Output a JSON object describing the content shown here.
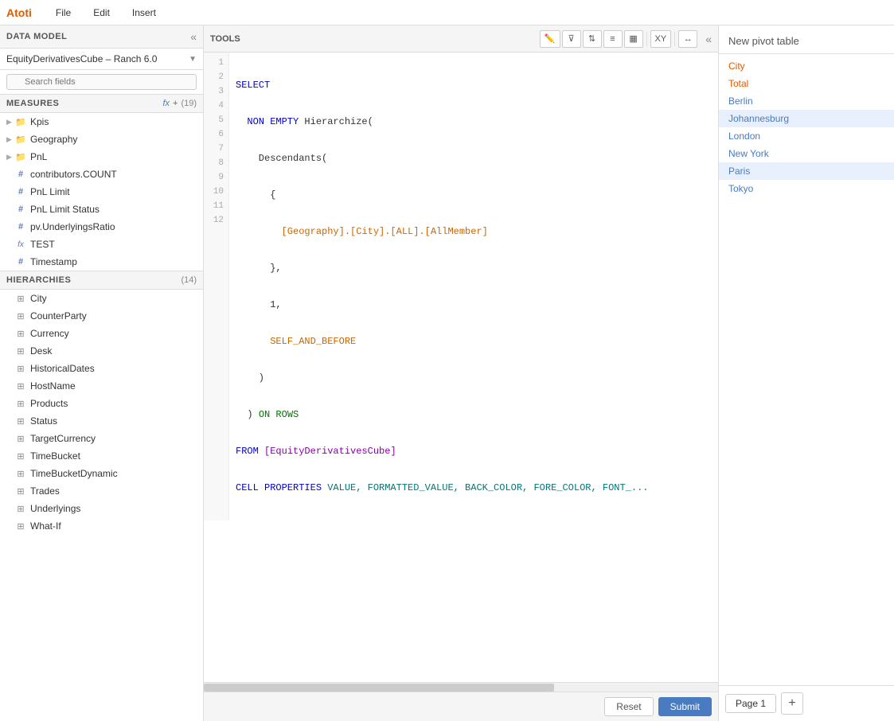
{
  "app": {
    "logo": "Atoti",
    "menu_items": [
      "File",
      "Edit",
      "Insert"
    ]
  },
  "left_panel": {
    "header": "DATA MODEL",
    "cube_selector": "EquityDerivativesCube – Ranch 6.0",
    "search_placeholder": "Search fields",
    "measures_section": {
      "title": "MEASURES",
      "fx_label": "fx",
      "plus_label": "+",
      "count_label": "(19)",
      "items": [
        {
          "name": "Kpis",
          "icon": "folder",
          "type": "folder"
        },
        {
          "name": "Geography",
          "icon": "folder",
          "type": "folder"
        },
        {
          "name": "PnL",
          "icon": "folder",
          "type": "folder"
        },
        {
          "name": "contributors.COUNT",
          "icon": "hash",
          "type": "measure"
        },
        {
          "name": "PnL Limit",
          "icon": "hash",
          "type": "measure"
        },
        {
          "name": "PnL Limit Status",
          "icon": "hash",
          "type": "measure"
        },
        {
          "name": "pv.UnderlyingsRatio",
          "icon": "hash",
          "type": "measure"
        },
        {
          "name": "TEST",
          "icon": "fx",
          "type": "calc"
        },
        {
          "name": "Timestamp",
          "icon": "hash",
          "type": "measure"
        }
      ]
    },
    "hierarchies_section": {
      "title": "HIERARCHIES",
      "count_label": "(14)",
      "items": [
        {
          "name": "City"
        },
        {
          "name": "CounterParty"
        },
        {
          "name": "Currency"
        },
        {
          "name": "Desk"
        },
        {
          "name": "HistoricalDates"
        },
        {
          "name": "HostName"
        },
        {
          "name": "Products"
        },
        {
          "name": "Status"
        },
        {
          "name": "TargetCurrency"
        },
        {
          "name": "TimeBucket"
        },
        {
          "name": "TimeBucketDynamic"
        },
        {
          "name": "Trades"
        },
        {
          "name": "Underlyings"
        },
        {
          "name": "What-If"
        }
      ]
    }
  },
  "tools_panel": {
    "title": "TOOLS",
    "toolbar_buttons": [
      "pencil",
      "filter",
      "sort-az",
      "bar-chart",
      "table",
      "xy",
      "arrows"
    ],
    "code_lines": [
      {
        "num": 1,
        "tokens": [
          {
            "text": "SELECT",
            "cls": "kw-blue"
          }
        ]
      },
      {
        "num": 2,
        "tokens": [
          {
            "text": "  NON EMPTY ",
            "cls": "kw-blue"
          },
          {
            "text": "Hierarchize(",
            "cls": "text-black"
          }
        ]
      },
      {
        "num": 3,
        "tokens": [
          {
            "text": "    Descendants(",
            "cls": "text-black"
          }
        ]
      },
      {
        "num": 4,
        "tokens": [
          {
            "text": "      {",
            "cls": "text-black"
          }
        ]
      },
      {
        "num": 5,
        "tokens": [
          {
            "text": "        [Geography].[City].[ALL].[AllMember]",
            "cls": "kw-orange"
          }
        ]
      },
      {
        "num": 6,
        "tokens": [
          {
            "text": "      },",
            "cls": "text-black"
          }
        ]
      },
      {
        "num": 7,
        "tokens": [
          {
            "text": "      1,",
            "cls": "text-black"
          }
        ]
      },
      {
        "num": 8,
        "tokens": [
          {
            "text": "      SELF_AND_BEFORE",
            "cls": "kw-orange"
          }
        ]
      },
      {
        "num": 9,
        "tokens": [
          {
            "text": "    )",
            "cls": "text-black"
          }
        ]
      },
      {
        "num": 10,
        "tokens": [
          {
            "text": "  ) ",
            "cls": "text-black"
          },
          {
            "text": "ON ROWS",
            "cls": "kw-green"
          }
        ]
      },
      {
        "num": 11,
        "tokens": [
          {
            "text": "FROM ",
            "cls": "kw-blue"
          },
          {
            "text": "[EquityDerivativesCube]",
            "cls": "kw-purple"
          }
        ]
      },
      {
        "num": 12,
        "tokens": [
          {
            "text": "CELL PROPERTIES ",
            "cls": "kw-blue"
          },
          {
            "text": "VALUE, FORMATTED_VALUE, BACK_COLOR, FORE_COLOR, FONT_...",
            "cls": "kw-teal"
          }
        ]
      }
    ],
    "reset_label": "Reset",
    "submit_label": "Submit"
  },
  "pivot_panel": {
    "title": "New pivot table",
    "items": [
      {
        "name": "City",
        "color": "city"
      },
      {
        "name": "Total",
        "color": "total"
      },
      {
        "name": "Berlin",
        "color": "city-member"
      },
      {
        "name": "Johannesburg",
        "color": "city-member",
        "selected": true
      },
      {
        "name": "London",
        "color": "city-member"
      },
      {
        "name": "New York",
        "color": "city-member"
      },
      {
        "name": "Paris",
        "color": "city-member",
        "selected": true
      },
      {
        "name": "Tokyo",
        "color": "city-member"
      }
    ],
    "page_label": "Page 1",
    "add_label": "+"
  }
}
